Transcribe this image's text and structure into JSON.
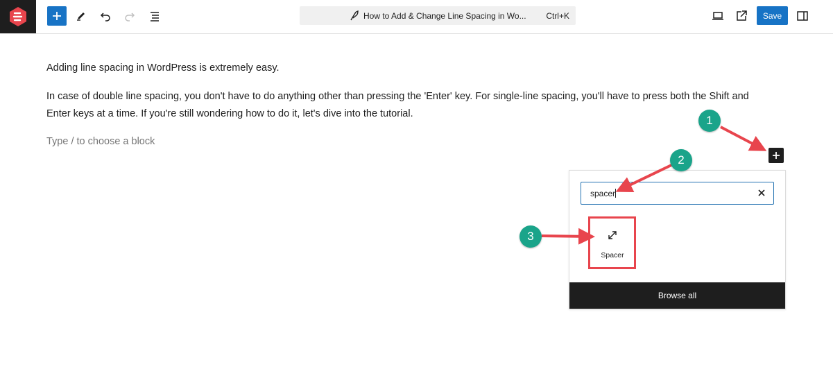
{
  "toolbar": {
    "document_title": "How to Add & Change Line Spacing in Wo...",
    "shortcut": "Ctrl+K",
    "save_label": "Save"
  },
  "content": {
    "paragraph_1": "Adding line spacing in WordPress is extremely easy.",
    "paragraph_2_line_1": "In case of double line spacing, you don't have to do anything other than pressing the 'Enter' key. For single-line spacing, you'll have to press both the Shift and",
    "paragraph_2_line_2": "Enter keys at a time. If you're still wondering how to do it, let's dive into the tutorial.",
    "block_placeholder": "Type / to choose a block"
  },
  "inserter": {
    "search_value": "spacer",
    "results": [
      {
        "label": "Spacer",
        "icon": "resize-diagonal-icon"
      }
    ],
    "browse_all_label": "Browse all"
  },
  "annotations": {
    "step_1": "1",
    "step_2": "2",
    "step_3": "3"
  },
  "colors": {
    "accent": "#1773c5",
    "annotation_green": "#1aa48a",
    "annotation_red": "#e8454d",
    "dark": "#1e1e1e"
  }
}
